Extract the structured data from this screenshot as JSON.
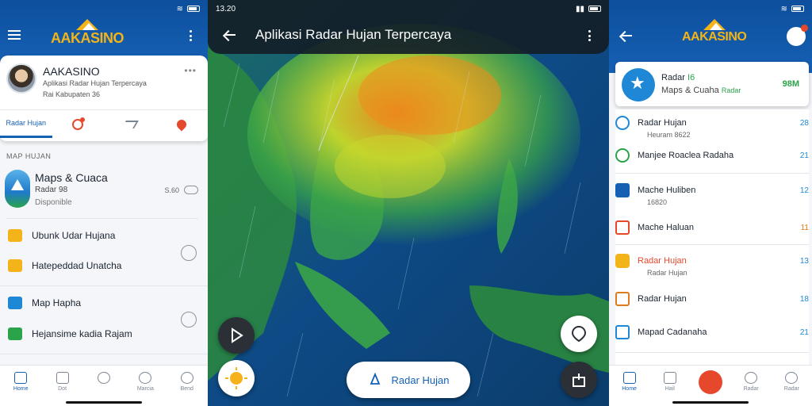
{
  "screen1": {
    "status_time": "",
    "logo_name": "AAKASINO",
    "logo_sub": "",
    "profile": {
      "name": "AAKASINO",
      "subtitle": "Aplikasi Radar Hujan Terpercaya",
      "location": "Rai Kabupaten 36",
      "more": "•••",
      "tabs": [
        {
          "label": "Radar Hujan"
        },
        {
          "label": ""
        },
        {
          "label": ""
        },
        {
          "label": ""
        }
      ]
    },
    "section_title": "MAP HUJAN",
    "feature": {
      "title": "Maps & Cuaca",
      "sub1": "Radar 98",
      "sub2": "Disponible",
      "right_label": "S.60"
    },
    "list": [
      {
        "label": "Ubunk Udar Hujana",
        "color": "#f2b418"
      },
      {
        "label": "Hatepeddad Unatcha",
        "color": "#f2b418"
      },
      {
        "label": "Map Hapha",
        "color": "#1e88d6"
      },
      {
        "label": "Hejansime kadia Rajam",
        "color": "#2aa34a"
      }
    ],
    "nav": [
      {
        "label": "Home",
        "active": true
      },
      {
        "label": "Dot"
      },
      {
        "label": ""
      },
      {
        "label": "Marcia"
      },
      {
        "label": "Bend"
      }
    ]
  },
  "screen2": {
    "status_time": "13.20",
    "title": "Aplikasi Radar Hujan Terpercaya",
    "pill_label": "Radar Hujan",
    "cities": [
      {
        "label": ""
      },
      {
        "label": ""
      },
      {
        "label": ""
      },
      {
        "label": ""
      },
      {
        "label": ""
      },
      {
        "label": ""
      },
      {
        "label": ""
      },
      {
        "label": ""
      }
    ],
    "colors": {
      "rain_heavy": "#f08a1c",
      "rain_mid": "#c7d72b",
      "rain_light": "#3aa548",
      "sea": "#0b3d6b"
    }
  },
  "screen3": {
    "logo_name": "AAKASINO",
    "hero": {
      "title": "Radar",
      "title_green": "I6",
      "sub": "Maps & Cuaha",
      "sub_green": "Radar",
      "right": "98M"
    },
    "rows": [
      {
        "label": "Radar Hujan",
        "sub": "Heuram 8622",
        "value": "28",
        "color": "#1e88d6"
      },
      {
        "label": "Manjee Roaclea Radaha",
        "value": "21",
        "color": "#2aa34a"
      },
      {
        "label": "Mache Huliben",
        "sub": "16820",
        "value": "12",
        "color": "#1660b4"
      },
      {
        "label": "Mache Haluan",
        "value": "11",
        "color": "#e5482b",
        "orange": true
      },
      {
        "label": "Radar Hujan",
        "sub": "Radar Hujan",
        "value": "13",
        "color": "#f2b418",
        "red_label": true
      },
      {
        "label": "Radar Hujan",
        "value": "18",
        "color": "#e07b1c"
      },
      {
        "label": "Mapad Cadanaha",
        "value": "21",
        "color": "#1e88d6"
      }
    ],
    "nav": [
      {
        "label": "Home",
        "active": true
      },
      {
        "label": "Hail"
      },
      {
        "label": ""
      },
      {
        "label": "Radar"
      },
      {
        "label": "Radar"
      }
    ]
  }
}
